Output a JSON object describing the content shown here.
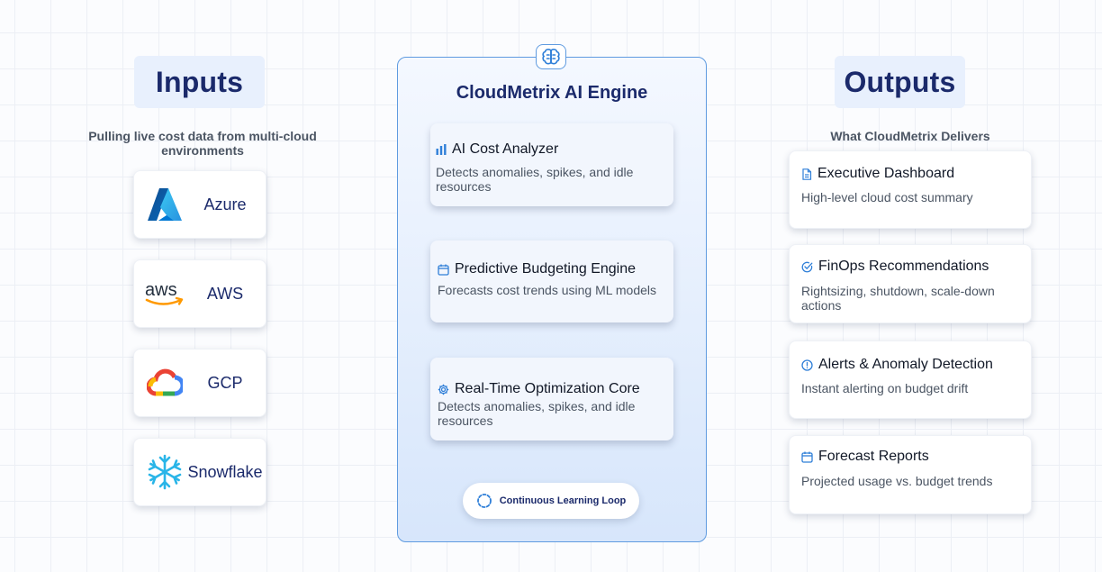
{
  "inputs": {
    "heading": "Inputs",
    "subtitle": "Pulling live cost data from multi-cloud environments",
    "sources": [
      {
        "name": "Azure",
        "icon": "azure-logo"
      },
      {
        "name": "AWS",
        "icon": "aws-logo"
      },
      {
        "name": "GCP",
        "icon": "gcp-logo"
      },
      {
        "name": "Snowflake",
        "icon": "snowflake-logo"
      }
    ]
  },
  "engine": {
    "icon": "brain-icon",
    "title": "CloudMetrix AI Engine",
    "modules": [
      {
        "title": "AI Cost Analyzer",
        "description": "Detects anomalies, spikes, and idle resources",
        "icon": "bar-chart-icon"
      },
      {
        "title": "Predictive Budgeting Engine",
        "description": "Forecasts cost trends using ML models",
        "icon": "calendar-icon"
      },
      {
        "title": "Real-Time Optimization Core",
        "description": "Detects anomalies, spikes, and idle resources",
        "icon": "gear-icon"
      }
    ],
    "loop_label": "Continuous Learning Loop",
    "loop_icon": "refresh-icon"
  },
  "outputs": {
    "heading": "Outputs",
    "subtitle": "What CloudMetrix Delivers",
    "items": [
      {
        "title": "Executive Dashboard",
        "description": "High-level cloud cost summary",
        "icon": "document-icon"
      },
      {
        "title": "FinOps Recommendations",
        "description": "Rightsizing, shutdown, scale-down actions",
        "icon": "check-circle-icon"
      },
      {
        "title": "Alerts & Anomaly Detection",
        "description": "Instant alerting on budget drift",
        "icon": "alert-circle-icon"
      },
      {
        "title": "Forecast Reports",
        "description": "Projected usage vs. budget trends",
        "icon": "calendar-icon"
      }
    ]
  },
  "colors": {
    "accent": "#2f7fd8",
    "heading_text": "#1b2a6b",
    "heading_bg": "#e8f0fd"
  }
}
